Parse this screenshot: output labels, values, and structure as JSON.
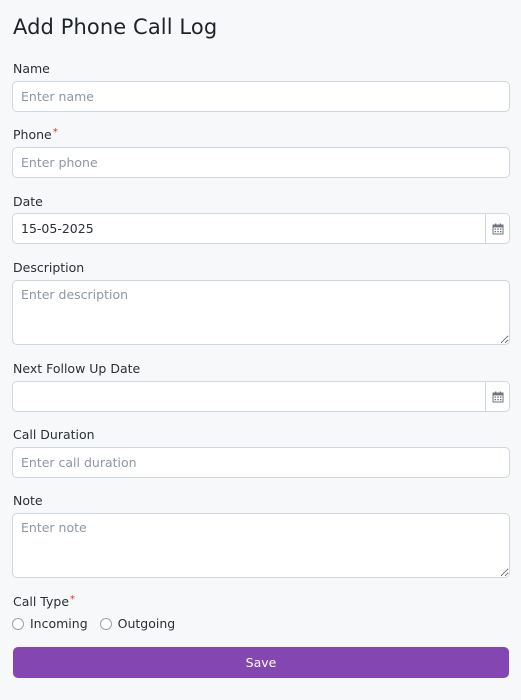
{
  "form": {
    "title": "Add Phone Call Log",
    "name": {
      "label": "Name",
      "placeholder": "Enter name",
      "value": ""
    },
    "phone": {
      "label": "Phone",
      "required_mark": "*",
      "placeholder": "Enter phone",
      "value": ""
    },
    "date": {
      "label": "Date",
      "value": "15-05-2025"
    },
    "description": {
      "label": "Description",
      "placeholder": "Enter description",
      "value": ""
    },
    "next_follow_up": {
      "label": "Next Follow Up Date",
      "value": ""
    },
    "call_duration": {
      "label": "Call Duration",
      "placeholder": "Enter call duration",
      "value": ""
    },
    "note": {
      "label": "Note",
      "placeholder": "Enter note",
      "value": ""
    },
    "call_type": {
      "label": "Call Type",
      "required_mark": "*",
      "options": [
        {
          "label": "Incoming",
          "selected": false
        },
        {
          "label": "Outgoing",
          "selected": false
        }
      ]
    },
    "save_label": "Save"
  },
  "colors": {
    "primary": "#8446b0",
    "required": "#e03131",
    "border": "#cfd6df",
    "background": "#f7f8fa"
  },
  "icons": {
    "date_picker": "calendar-icon",
    "textarea_resize": "resize-handle-icon"
  }
}
